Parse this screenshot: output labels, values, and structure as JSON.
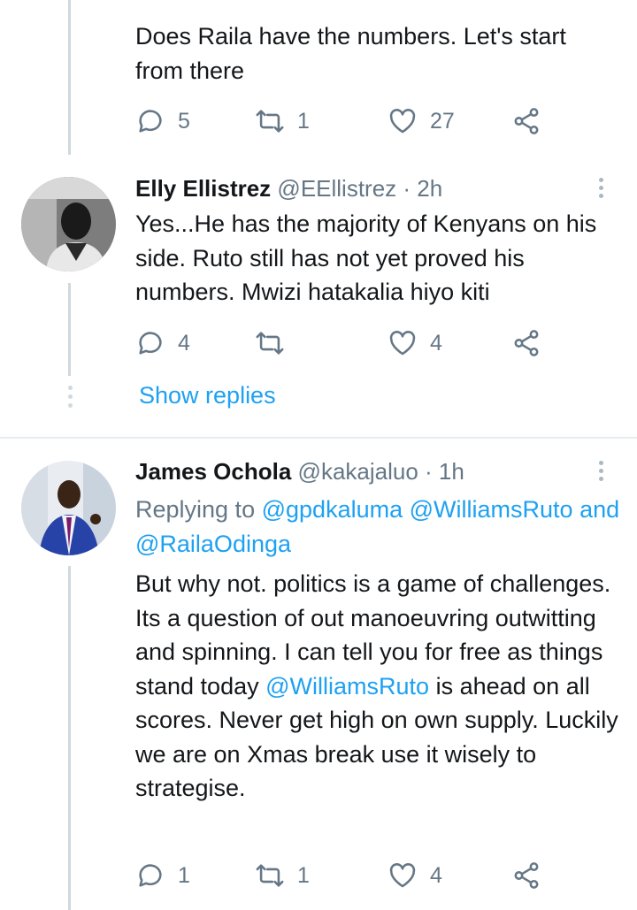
{
  "tweet1": {
    "text": "Does Raila have the numbers. Let's start from there",
    "actions": {
      "replies": "5",
      "retweets": "1",
      "likes": "27"
    }
  },
  "tweet2": {
    "name": "Elly Ellistrez",
    "handle": "@EEllistrez",
    "time": "2h",
    "text": "Yes...He has the majority of Kenyans on his side. Ruto still has not yet proved his numbers. Mwizi hatakalia hiyo kiti",
    "actions": {
      "replies": "4",
      "retweets": "",
      "likes": "4"
    }
  },
  "show_replies": "Show replies",
  "tweet3": {
    "name": "James Ochola",
    "handle": "@kakajaluo",
    "time": "1h",
    "replying_label": "Replying to",
    "replying_to": [
      "@gpdkaluma",
      "@WilliamsRuto"
    ],
    "replying_and": "and",
    "replying_last": "@RailaOdinga",
    "text_part1": "But why not. politics is a game of challenges. Its a question of out manoeuvring outwitting and spinning. I can tell you for free as things stand today",
    "mention": "@WilliamsRuto",
    "text_part2": "is ahead on all scores. Never get high on own supply. Luckily we are on Xmas break use it wisely to strategise.",
    "actions": {
      "replies": "1",
      "retweets": "1",
      "likes": "4"
    }
  },
  "colors": {
    "link": "#1da1f2",
    "muted": "#657786",
    "text": "#14171a"
  },
  "icons": [
    "reply-icon",
    "retweet-icon",
    "like-icon",
    "share-icon",
    "more-icon"
  ]
}
